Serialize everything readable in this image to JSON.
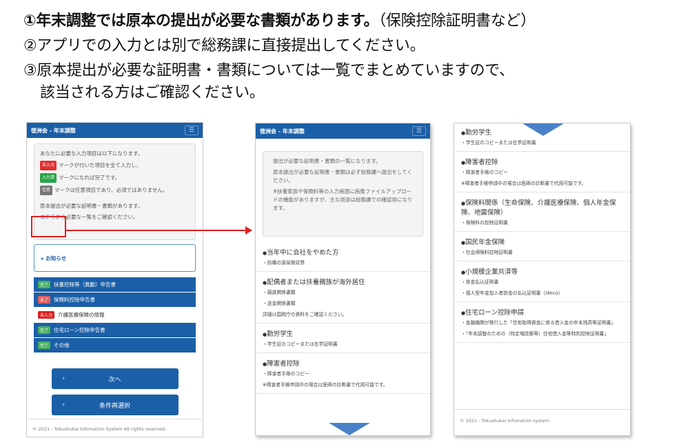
{
  "headings": {
    "line1_bold": "①年末調整では原本の提出が必要な書類があります。",
    "line1_rest": "（保険控除証明書など）",
    "line2": "②アプリでの入力とは別で総務課に直接提出してください。",
    "line3": "③原本提出が必要な証明書・書類については一覧でまとめていますので、",
    "line4": "該当される方はご確認ください。"
  },
  "screen1": {
    "app_title": "徳洲会 - 年末調整",
    "menu_icon": "hamburger-icon",
    "intro": "あなたに必要な入力項目は以下になります。",
    "tag_required": "未入力",
    "line_required": "マークが付いた項目を全て入力し、",
    "tag_done": "入力済",
    "line_done": "マークになれば完了です。",
    "tag_optional": "任意",
    "line_optional": "マークは任意項目であり、必須ではありません。",
    "original_note": "原本提出が必要な証明書・書類があります。",
    "link_text": "コチラ",
    "link_suffix": "から必要な一覧をご確認ください。",
    "notice_label": "▸ お知らせ",
    "rows": [
      {
        "badge": "完了",
        "label": "扶養控除等（異動）申告書",
        "style": "blue",
        "badge_style": "done"
      },
      {
        "badge": "未了",
        "label": "保険料控除申告書",
        "style": "blue",
        "badge_style": "todo"
      },
      {
        "badge": "未入力",
        "label": "介護医療保険の情報",
        "style": "plain",
        "badge_style": "red"
      },
      {
        "badge": "完了",
        "label": "住宅ローン控除申告書",
        "style": "blue",
        "badge_style": "done"
      },
      {
        "badge": "完了",
        "label": "その他",
        "style": "blue",
        "badge_style": "done"
      }
    ],
    "next_button": "次へ",
    "reselect_button": "条件再選択",
    "chevron": "›",
    "footer": "© 2021 - Tokushukai Infomation System All rights reserved."
  },
  "screen2": {
    "app_title": "徳洲会 - 年末調整",
    "info1": "提出が必要な証明書・書類の一覧になります。",
    "info2": "原本提出が必要な証明書・書類は必ず総務課へ提出をしてください。",
    "info3": "※扶養家族や保険料等の入力画面に画像ファイルアップロードの機能がありますが、主な用途は総務課での確認用になります。",
    "sections": [
      {
        "title": "当年中に会社をやめた方",
        "lines": [
          "・前職の源泉徴収票"
        ]
      },
      {
        "title": "配偶者または扶養親族が海外居住",
        "lines": [
          "・親族関係書類",
          "・送金関係書類"
        ],
        "link": "詳細は国税庁の資料をご確認ください。"
      },
      {
        "title": "勤労学生",
        "lines": [
          "・学生証のコピーまたは在学証明書"
        ]
      },
      {
        "title": "障害者控除",
        "lines": [
          "・障害者手帳のコピー"
        ],
        "note": "※障害者手帳申請中の場合は医師の診断書で代用可能です。"
      }
    ]
  },
  "screen3": {
    "sections": [
      {
        "title": "勤労学生",
        "lines": [
          "・学生証のコピーまたは在学証明書"
        ]
      },
      {
        "title": "障害者控除",
        "lines": [
          "・障害者手帳のコピー"
        ],
        "note": "※障害者手帳申請中の場合は医師の診断書で代用可能です。"
      },
      {
        "title": "保険料関係（生命保険、介護医療保険、個人年金保険、地震保険）",
        "lines": [
          "・保険料の控除証明書"
        ]
      },
      {
        "title": "国民年金保険",
        "lines": [
          "・社会保険料控除証明書"
        ]
      },
      {
        "title": "小規模企業共済等",
        "lines": [
          "・掛金払込証明書",
          "・個人型年金加入者掛金の払込証明書（ideco）"
        ]
      },
      {
        "title": "住宅ローン控除申請",
        "lines": [
          "・金融機関が発行した「住宅取得資金に係る借入金の年末残高等証明書」",
          "・「年末調整のための（特定増改築等）住宅借入金等特別控除証明書」"
        ]
      }
    ],
    "footer": "© 2021 - Tokushukai Infomation system."
  },
  "colors": {
    "appbar": "#1b5fa8",
    "highlight": "#e02020",
    "scroll_arrow": "#4a80c8"
  }
}
